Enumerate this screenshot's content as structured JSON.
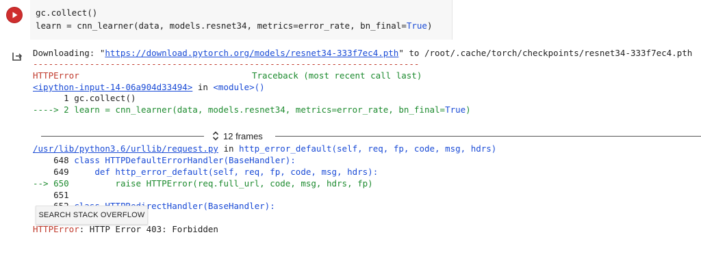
{
  "cell": {
    "run_icon": "play-circle-icon",
    "run_color": "#cf2e2e",
    "code_lines": [
      {
        "text": "gc.collect()"
      },
      {
        "prefix": "learn = cnn_learner(data, models.resnet34, metrics=error_rate, bn_final=",
        "keyword": "True",
        "suffix": ")"
      }
    ]
  },
  "output": {
    "output_icon": "output-arrow-icon",
    "download": {
      "prefix": "Downloading: \"",
      "url": "https://download.pytorch.org/models/resnet34-333f7ec4.pth",
      "suffix": "\" to /root/.cache/torch/checkpoints/resnet34-333f7ec4.pth"
    },
    "separator": "---------------------------------------------------------------------------",
    "error_name": "HTTPError",
    "traceback_header": "Traceback (most recent call last)",
    "frame1": {
      "file_link": "<ipython-input-14-06a904d33494>",
      "in_word": " in ",
      "module": "<module>()",
      "line1": "      1 gc.collect()",
      "arrow": "----> ",
      "line2_prefix": "2 learn = cnn_learner(data, models.resnet34, metrics=error_rate, bn_final=",
      "line2_keyword": "True",
      "line2_suffix": ")"
    },
    "frames_toggle": {
      "icon": "unfold-icon",
      "label": "12 frames"
    },
    "frame2": {
      "file_link": "/usr/lib/python3.6/urllib/request.py",
      "in_word": " in ",
      "func": "http_error_default(self, req, fp, code, msg, hdrs)",
      "l648_num": "    648 ",
      "l648_code": "class HTTPDefaultErrorHandler(BaseHandler):",
      "l649_num": "    649     ",
      "l649_code": "def http_error_default(self, req, fp, code, msg, hdrs):",
      "l650_arrow": "--> 650         ",
      "l650_code": "raise HTTPError(req.full_url, code, msg, hdrs, fp)",
      "l651": "    651",
      "l652_num": "    652 ",
      "l652_code": "class HTTPRedirectHandler(BaseHandler):"
    },
    "final_error": {
      "name": "HTTPError",
      "message": ": HTTP Error 403: Forbidden"
    }
  },
  "search_stack_overflow_label": "SEARCH STACK OVERFLOW"
}
